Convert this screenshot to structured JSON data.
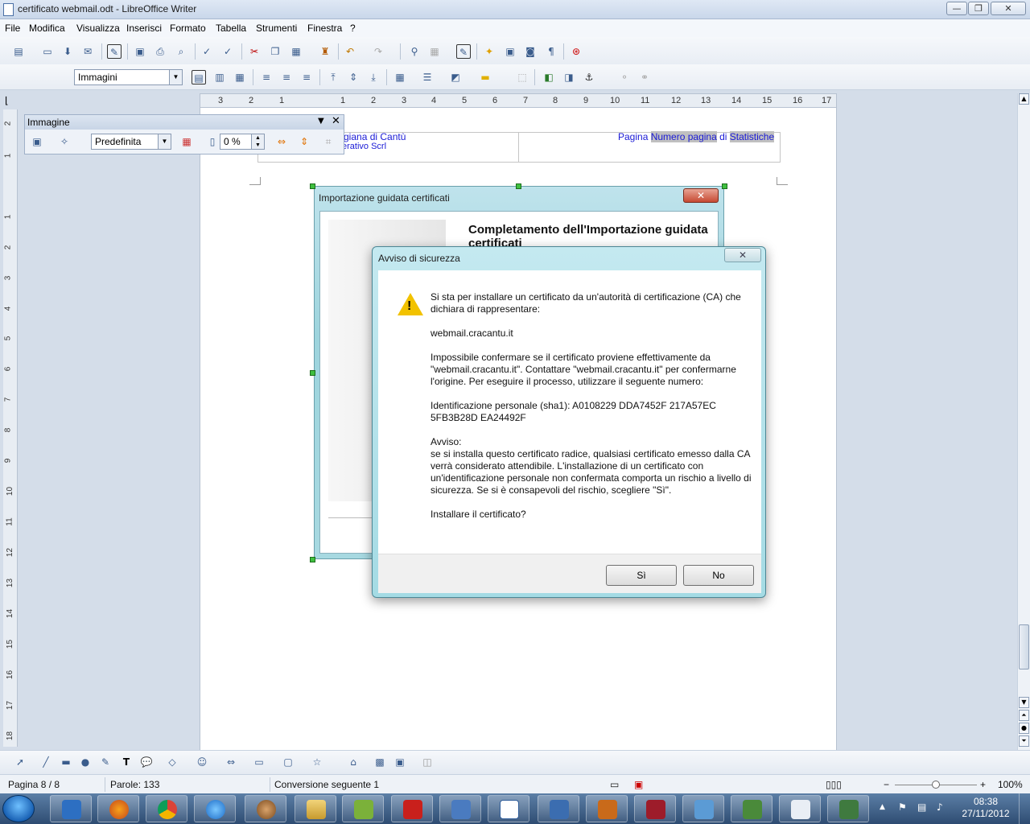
{
  "window": {
    "title": "certificato webmail.odt - LibreOffice Writer",
    "min_glyph": "—",
    "max_glyph": "❐",
    "close_glyph": "✕"
  },
  "menu": [
    "File",
    "Modifica",
    "Visualizza",
    "Inserisci",
    "Formato",
    "Tabella",
    "Strumenti",
    "Finestra",
    "?"
  ],
  "toolbar2": {
    "style_combo": "Immagini"
  },
  "ruler": {
    "h_ticks": [
      "3",
      "2",
      "1",
      "1",
      "1",
      "2",
      "3",
      "4",
      "5",
      "6",
      "7",
      "8",
      "9",
      "10",
      "11",
      "12",
      "13",
      "14",
      "15",
      "16",
      "17"
    ],
    "v_ticks": [
      "2",
      "1",
      "1",
      "2",
      "3",
      "4",
      "5",
      "6",
      "7",
      "8",
      "9",
      "10",
      "11",
      "12",
      "13",
      "14",
      "15",
      "16",
      "17",
      "18"
    ]
  },
  "image_toolbar": {
    "title": "Immagine",
    "filter_combo": "Predefinita",
    "transparency": "0 %"
  },
  "page_header": {
    "left_line1": "tigiana di Cantù",
    "left_line2": "erativo Scrl",
    "right_prefix": "Pagina ",
    "right_field1": "Numero pagina",
    "right_mid": " di ",
    "right_field2": "Statistiche"
  },
  "wizard": {
    "title": "Importazione guidata certificati",
    "heading": "Completamento dell'Importazione guidata certificati",
    "close_glyph": "✕"
  },
  "security_dialog": {
    "title": "Avviso di sicurezza",
    "close_glyph": "✕",
    "warning_mark": "!",
    "paragraphs": [
      "Si sta per installare un certificato da un'autorità di certificazione (CA) che dichiara di rappresentare:",
      "webmail.cracantu.it",
      "Impossibile confermare se il certificato proviene effettivamente da \"webmail.cracantu.it\". Contattare \"webmail.cracantu.it\" per confermarne l'origine. Per eseguire il processo, utilizzare il seguente numero:",
      "Identificazione personale (sha1): A0108229 DDA7452F 217A57EC 5FB3B28D EA24492F",
      "Avviso:\nse si installa questo certificato radice, qualsiasi certificato emesso dalla CA verrà considerato attendibile. L'installazione di un certificato con un'identificazione personale non confermata comporta un rischio a livello di sicurezza. Se si è consapevoli del rischio, scegliere \"Sì\".",
      "Installare il certificato?"
    ],
    "yes_label": "Sì",
    "no_label": "No"
  },
  "statusbar": {
    "page": "Pagina 8 / 8",
    "words": "Parole: 133",
    "mode": "Conversione seguente 1",
    "zoom": "100%"
  },
  "taskbar": {
    "time": "08:38",
    "date": "27/11/2012"
  },
  "colors": {
    "field_highlight": "#c0c0c0",
    "header_text": "#1a1ad6",
    "dialog_frame": "#a4dbe4"
  }
}
